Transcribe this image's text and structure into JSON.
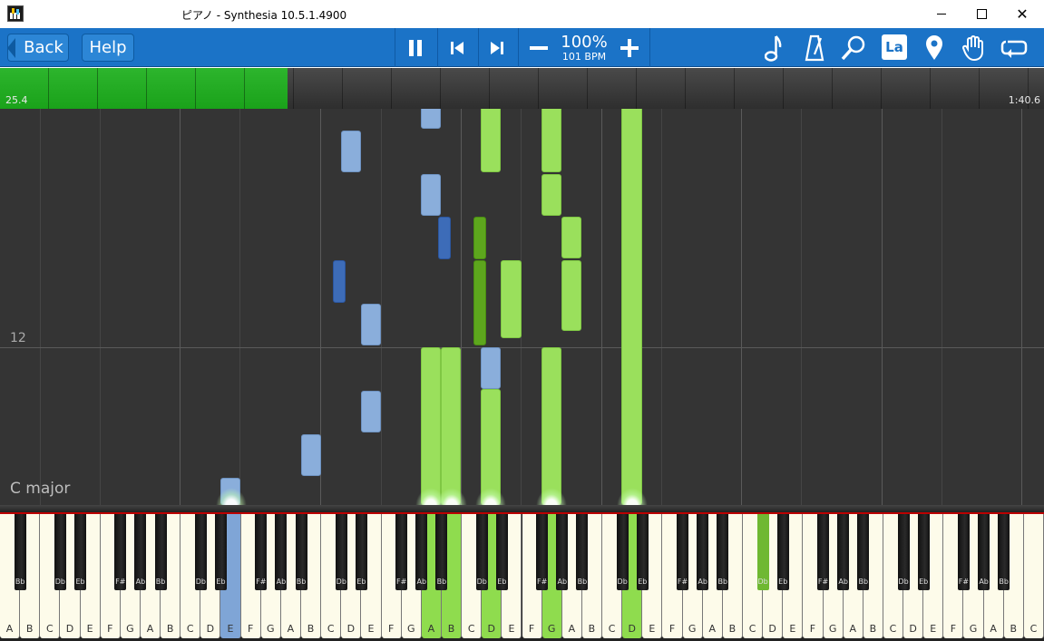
{
  "window": {
    "title": "ピアノ - Synthesia 10.5.1.4900",
    "minimize_glyph": "",
    "close_glyph": "✕"
  },
  "toolbar": {
    "back_label": "Back",
    "help_label": "Help",
    "speed_percent": "100%",
    "bpm": "101 BPM",
    "la_label": "La",
    "icons": [
      "pause-icon",
      "skip-back-icon",
      "skip-forward-icon",
      "minus-icon",
      "plus-icon",
      "note-icon",
      "metronome-icon",
      "magnifier-icon",
      "la-icon",
      "location-pin-icon",
      "hand-icon",
      "loop-icon"
    ]
  },
  "progress": {
    "start_time": "25.4",
    "end_time": "1:40.6",
    "fraction": 0.275,
    "fill_color": "#1aa21a"
  },
  "roll": {
    "measure_number": "12",
    "key_signature": "C major"
  },
  "keyboard": {
    "white_labels": [
      "A",
      "B",
      "C",
      "D",
      "E",
      "F",
      "G",
      "A",
      "B",
      "C",
      "D",
      "E",
      "F",
      "G",
      "A",
      "B",
      "C",
      "D",
      "E",
      "F",
      "G",
      "A",
      "B",
      "C",
      "D",
      "E",
      "F",
      "G",
      "A",
      "B",
      "C",
      "D",
      "E",
      "F",
      "G",
      "A",
      "B",
      "C",
      "D",
      "E",
      "F",
      "G",
      "A",
      "B",
      "C",
      "D",
      "E",
      "F",
      "G",
      "A",
      "B",
      "C"
    ],
    "black_labels": [
      "Bb",
      "Db",
      "Eb",
      "F#",
      "Ab",
      "Bb",
      "Db",
      "Eb",
      "F#",
      "Ab",
      "Bb",
      "Db",
      "Eb",
      "F#",
      "Ab",
      "Bb",
      "Db",
      "Eb",
      "F#",
      "Ab",
      "Bb",
      "Db",
      "Eb",
      "F#",
      "Ab",
      "Bb",
      "Db",
      "Eb",
      "F#",
      "Ab",
      "Bb",
      "Db",
      "Eb",
      "F#",
      "Ab",
      "Bb"
    ],
    "lit_white_green": [
      21,
      22,
      24,
      27,
      31
    ],
    "lit_white_blue": [
      11
    ],
    "lit_black_green": [
      26
    ],
    "colors": {
      "green": "#8fdc4e",
      "blue": "#7fa5d6"
    }
  }
}
